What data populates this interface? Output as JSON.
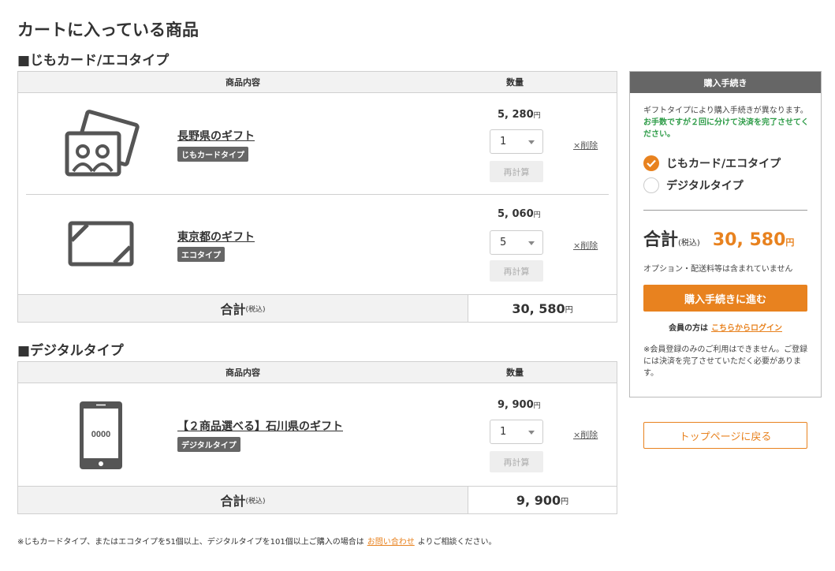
{
  "page_title": "カートに入っている商品",
  "sections": {
    "physical": {
      "title": "■じもカード/エコタイプ",
      "col_item": "商品内容",
      "col_qty": "数量",
      "items": [
        {
          "name": "長野県のギフト",
          "badge": "じもカードタイプ",
          "price": "5, 280",
          "yen": "円",
          "qty": "1",
          "recalc": "再計算",
          "delete": "×削除"
        },
        {
          "name": "東京都のギフト",
          "badge": "エコタイプ",
          "price": "5, 060",
          "yen": "円",
          "qty": "5",
          "recalc": "再計算",
          "delete": "×削除"
        }
      ],
      "total_label": "合計",
      "total_tax": "(税込)",
      "total_value": "30, 580",
      "total_yen": "円"
    },
    "digital": {
      "title": "■デジタルタイプ",
      "col_item": "商品内容",
      "col_qty": "数量",
      "items": [
        {
          "name": "【２商品選べる】石川県のギフト",
          "badge": "デジタルタイプ",
          "price": "9, 900",
          "yen": "円",
          "qty": "1",
          "recalc": "再計算",
          "delete": "×削除",
          "device_text": "0000"
        }
      ],
      "total_label": "合計",
      "total_tax": "(税込)",
      "total_value": "9, 900",
      "total_yen": "円"
    }
  },
  "sidebar": {
    "heading": "購入手続き",
    "note_plain": "ギフトタイプにより購入手続きが異なります。",
    "note_green": "お手数ですが２回に分けて決済を完了させてください。",
    "options": [
      {
        "label": "じもカード/エコタイプ",
        "selected": true
      },
      {
        "label": "デジタルタイプ",
        "selected": false
      }
    ],
    "total_label": "合計",
    "total_tax": "(税込)",
    "total_value": "30, 580",
    "total_yen": "円",
    "option_note": "オプション・配送料等は含まれていません",
    "proceed_button": "購入手続きに進む",
    "member_prefix": "会員の方は",
    "login_link": "こちらからログイン",
    "warning": "※会員登録のみのご利用はできません。ご登録には決済を完了させていただく必要があります。"
  },
  "top_page_button": "トップページに戻る",
  "footnote": {
    "before": "※じもカードタイプ、またはエコタイプを51個以上、デジタルタイプを101個以上ご購入の場合は",
    "link": "お問い合わせ",
    "after": "よりご相談ください。"
  },
  "colors": {
    "accent": "#e8821f",
    "green": "#2e9c48",
    "header_gray": "#666666"
  }
}
